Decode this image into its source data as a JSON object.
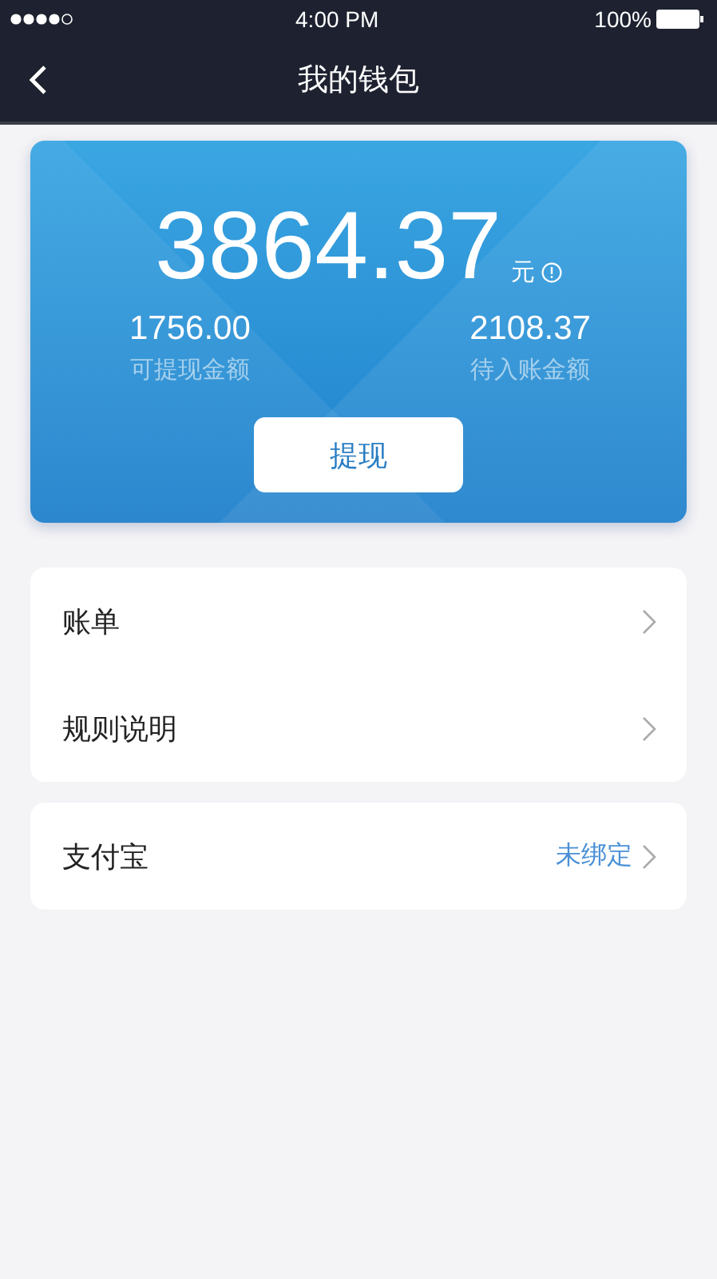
{
  "status_bar": {
    "time": "4:00 PM",
    "battery": "100%"
  },
  "nav": {
    "title": "我的钱包"
  },
  "balance": {
    "amount": "3864.37",
    "unit": "元",
    "button": "提现",
    "stats": [
      {
        "value": "1756.00",
        "label": "可提现金额"
      },
      {
        "value": "2108.37",
        "label": "待入账金额"
      }
    ]
  },
  "menu_groups": [
    {
      "items": [
        {
          "label": "账单"
        },
        {
          "label": "规则说明"
        }
      ]
    },
    {
      "items": [
        {
          "label": "支付宝",
          "value": "未绑定"
        }
      ]
    }
  ]
}
